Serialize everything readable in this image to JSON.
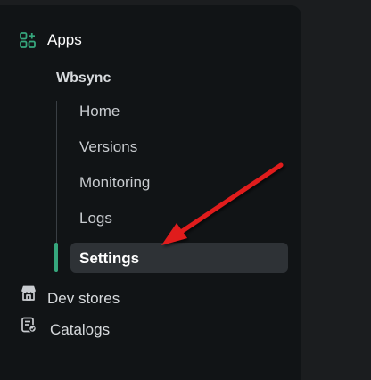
{
  "sidebar": {
    "apps": {
      "label": "Apps",
      "icon": "apps-add-icon",
      "accent": "#36a77d"
    },
    "app_name": "Wbsync",
    "items": [
      {
        "label": "Home"
      },
      {
        "label": "Versions"
      },
      {
        "label": "Monitoring"
      },
      {
        "label": "Logs"
      },
      {
        "label": "Settings",
        "active": true
      }
    ],
    "bottom": [
      {
        "label": "Dev stores",
        "icon": "store-icon"
      },
      {
        "label": "Catalogs",
        "icon": "catalog-icon"
      }
    ]
  },
  "annotation": {
    "color": "#e01e1e"
  }
}
